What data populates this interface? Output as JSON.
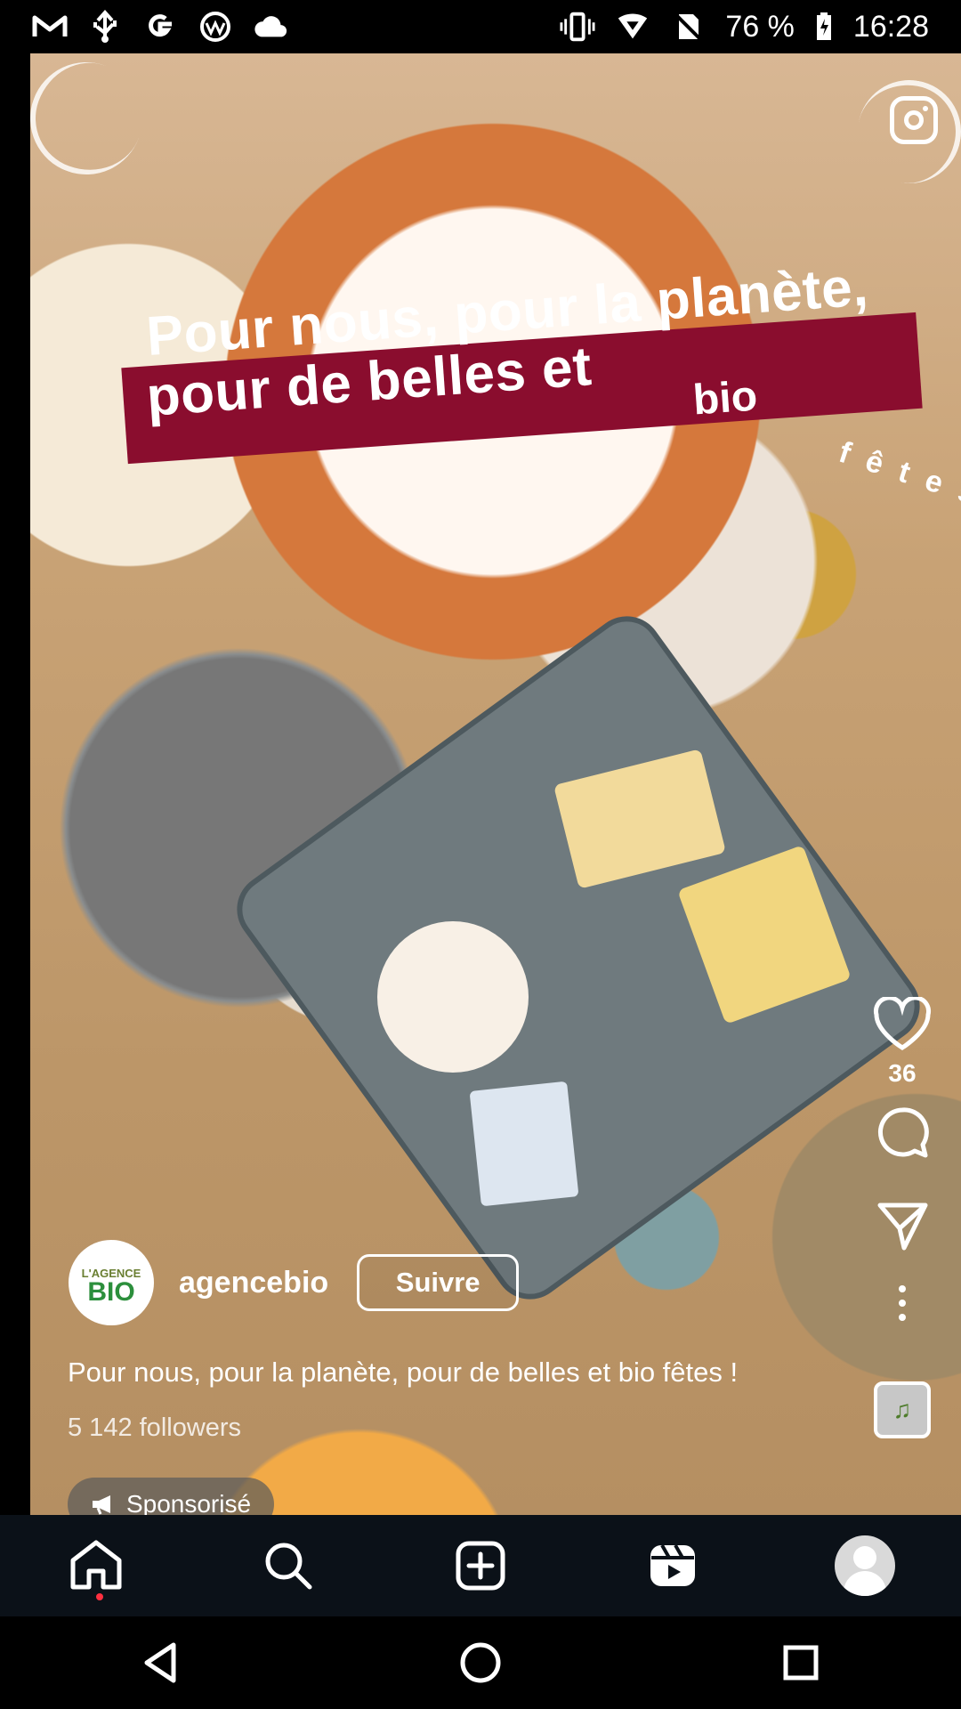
{
  "status_bar": {
    "battery_percent": "76 %",
    "time": "16:28",
    "icons": [
      "gmail-icon",
      "usb-icon",
      "google-icon",
      "app-icon",
      "cloud-icon",
      "vibrate-icon",
      "signal-icon",
      "no-sim-icon",
      "battery-icon"
    ]
  },
  "reel": {
    "headline_line_1": "Pour nous, pour la planète,",
    "headline_line_2": "pour de belles et",
    "headline_bio": "bio",
    "headline_fetes": "fêtes",
    "likes": "36",
    "account": {
      "username": "agencebio",
      "follow_label": "Suivre",
      "avatar_small": "L'AGENCE",
      "avatar_large": "BIO"
    },
    "caption": "Pour nous, pour la planète, pour de belles et bio fêtes !",
    "followers": "5 142 followers",
    "sponsored_label": "Sponsorisé"
  },
  "bottom_nav": {
    "items": [
      "home-icon",
      "search-icon",
      "create-icon",
      "reels-icon",
      "profile-avatar"
    ]
  }
}
